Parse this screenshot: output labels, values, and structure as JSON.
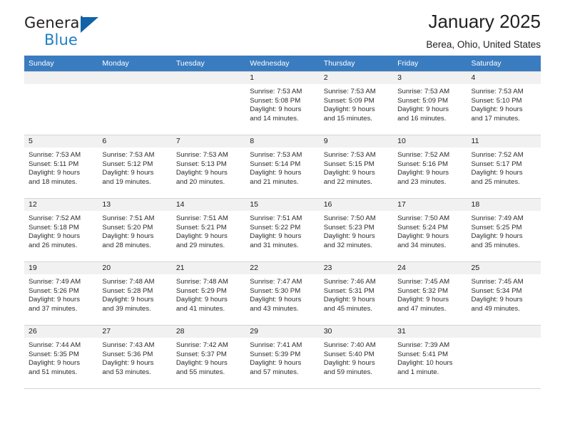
{
  "brand": {
    "name_top": "General",
    "name_bottom": "Blue",
    "triangle_color": "#1162a8",
    "blue_color": "#1f7fc4"
  },
  "header": {
    "title": "January 2025",
    "location": "Berea, Ohio, United States",
    "header_bg": "#3a7cc0"
  },
  "weekdays": [
    "Sunday",
    "Monday",
    "Tuesday",
    "Wednesday",
    "Thursday",
    "Friday",
    "Saturday"
  ],
  "weeks": [
    [
      {
        "day": "",
        "sunrise": "",
        "sunset": "",
        "daylight_1": "",
        "daylight_2": ""
      },
      {
        "day": "",
        "sunrise": "",
        "sunset": "",
        "daylight_1": "",
        "daylight_2": ""
      },
      {
        "day": "",
        "sunrise": "",
        "sunset": "",
        "daylight_1": "",
        "daylight_2": ""
      },
      {
        "day": "1",
        "sunrise": "Sunrise: 7:53 AM",
        "sunset": "Sunset: 5:08 PM",
        "daylight_1": "Daylight: 9 hours",
        "daylight_2": "and 14 minutes."
      },
      {
        "day": "2",
        "sunrise": "Sunrise: 7:53 AM",
        "sunset": "Sunset: 5:09 PM",
        "daylight_1": "Daylight: 9 hours",
        "daylight_2": "and 15 minutes."
      },
      {
        "day": "3",
        "sunrise": "Sunrise: 7:53 AM",
        "sunset": "Sunset: 5:09 PM",
        "daylight_1": "Daylight: 9 hours",
        "daylight_2": "and 16 minutes."
      },
      {
        "day": "4",
        "sunrise": "Sunrise: 7:53 AM",
        "sunset": "Sunset: 5:10 PM",
        "daylight_1": "Daylight: 9 hours",
        "daylight_2": "and 17 minutes."
      }
    ],
    [
      {
        "day": "5",
        "sunrise": "Sunrise: 7:53 AM",
        "sunset": "Sunset: 5:11 PM",
        "daylight_1": "Daylight: 9 hours",
        "daylight_2": "and 18 minutes."
      },
      {
        "day": "6",
        "sunrise": "Sunrise: 7:53 AM",
        "sunset": "Sunset: 5:12 PM",
        "daylight_1": "Daylight: 9 hours",
        "daylight_2": "and 19 minutes."
      },
      {
        "day": "7",
        "sunrise": "Sunrise: 7:53 AM",
        "sunset": "Sunset: 5:13 PM",
        "daylight_1": "Daylight: 9 hours",
        "daylight_2": "and 20 minutes."
      },
      {
        "day": "8",
        "sunrise": "Sunrise: 7:53 AM",
        "sunset": "Sunset: 5:14 PM",
        "daylight_1": "Daylight: 9 hours",
        "daylight_2": "and 21 minutes."
      },
      {
        "day": "9",
        "sunrise": "Sunrise: 7:53 AM",
        "sunset": "Sunset: 5:15 PM",
        "daylight_1": "Daylight: 9 hours",
        "daylight_2": "and 22 minutes."
      },
      {
        "day": "10",
        "sunrise": "Sunrise: 7:52 AM",
        "sunset": "Sunset: 5:16 PM",
        "daylight_1": "Daylight: 9 hours",
        "daylight_2": "and 23 minutes."
      },
      {
        "day": "11",
        "sunrise": "Sunrise: 7:52 AM",
        "sunset": "Sunset: 5:17 PM",
        "daylight_1": "Daylight: 9 hours",
        "daylight_2": "and 25 minutes."
      }
    ],
    [
      {
        "day": "12",
        "sunrise": "Sunrise: 7:52 AM",
        "sunset": "Sunset: 5:18 PM",
        "daylight_1": "Daylight: 9 hours",
        "daylight_2": "and 26 minutes."
      },
      {
        "day": "13",
        "sunrise": "Sunrise: 7:51 AM",
        "sunset": "Sunset: 5:20 PM",
        "daylight_1": "Daylight: 9 hours",
        "daylight_2": "and 28 minutes."
      },
      {
        "day": "14",
        "sunrise": "Sunrise: 7:51 AM",
        "sunset": "Sunset: 5:21 PM",
        "daylight_1": "Daylight: 9 hours",
        "daylight_2": "and 29 minutes."
      },
      {
        "day": "15",
        "sunrise": "Sunrise: 7:51 AM",
        "sunset": "Sunset: 5:22 PM",
        "daylight_1": "Daylight: 9 hours",
        "daylight_2": "and 31 minutes."
      },
      {
        "day": "16",
        "sunrise": "Sunrise: 7:50 AM",
        "sunset": "Sunset: 5:23 PM",
        "daylight_1": "Daylight: 9 hours",
        "daylight_2": "and 32 minutes."
      },
      {
        "day": "17",
        "sunrise": "Sunrise: 7:50 AM",
        "sunset": "Sunset: 5:24 PM",
        "daylight_1": "Daylight: 9 hours",
        "daylight_2": "and 34 minutes."
      },
      {
        "day": "18",
        "sunrise": "Sunrise: 7:49 AM",
        "sunset": "Sunset: 5:25 PM",
        "daylight_1": "Daylight: 9 hours",
        "daylight_2": "and 35 minutes."
      }
    ],
    [
      {
        "day": "19",
        "sunrise": "Sunrise: 7:49 AM",
        "sunset": "Sunset: 5:26 PM",
        "daylight_1": "Daylight: 9 hours",
        "daylight_2": "and 37 minutes."
      },
      {
        "day": "20",
        "sunrise": "Sunrise: 7:48 AM",
        "sunset": "Sunset: 5:28 PM",
        "daylight_1": "Daylight: 9 hours",
        "daylight_2": "and 39 minutes."
      },
      {
        "day": "21",
        "sunrise": "Sunrise: 7:48 AM",
        "sunset": "Sunset: 5:29 PM",
        "daylight_1": "Daylight: 9 hours",
        "daylight_2": "and 41 minutes."
      },
      {
        "day": "22",
        "sunrise": "Sunrise: 7:47 AM",
        "sunset": "Sunset: 5:30 PM",
        "daylight_1": "Daylight: 9 hours",
        "daylight_2": "and 43 minutes."
      },
      {
        "day": "23",
        "sunrise": "Sunrise: 7:46 AM",
        "sunset": "Sunset: 5:31 PM",
        "daylight_1": "Daylight: 9 hours",
        "daylight_2": "and 45 minutes."
      },
      {
        "day": "24",
        "sunrise": "Sunrise: 7:45 AM",
        "sunset": "Sunset: 5:32 PM",
        "daylight_1": "Daylight: 9 hours",
        "daylight_2": "and 47 minutes."
      },
      {
        "day": "25",
        "sunrise": "Sunrise: 7:45 AM",
        "sunset": "Sunset: 5:34 PM",
        "daylight_1": "Daylight: 9 hours",
        "daylight_2": "and 49 minutes."
      }
    ],
    [
      {
        "day": "26",
        "sunrise": "Sunrise: 7:44 AM",
        "sunset": "Sunset: 5:35 PM",
        "daylight_1": "Daylight: 9 hours",
        "daylight_2": "and 51 minutes."
      },
      {
        "day": "27",
        "sunrise": "Sunrise: 7:43 AM",
        "sunset": "Sunset: 5:36 PM",
        "daylight_1": "Daylight: 9 hours",
        "daylight_2": "and 53 minutes."
      },
      {
        "day": "28",
        "sunrise": "Sunrise: 7:42 AM",
        "sunset": "Sunset: 5:37 PM",
        "daylight_1": "Daylight: 9 hours",
        "daylight_2": "and 55 minutes."
      },
      {
        "day": "29",
        "sunrise": "Sunrise: 7:41 AM",
        "sunset": "Sunset: 5:39 PM",
        "daylight_1": "Daylight: 9 hours",
        "daylight_2": "and 57 minutes."
      },
      {
        "day": "30",
        "sunrise": "Sunrise: 7:40 AM",
        "sunset": "Sunset: 5:40 PM",
        "daylight_1": "Daylight: 9 hours",
        "daylight_2": "and 59 minutes."
      },
      {
        "day": "31",
        "sunrise": "Sunrise: 7:39 AM",
        "sunset": "Sunset: 5:41 PM",
        "daylight_1": "Daylight: 10 hours",
        "daylight_2": "and 1 minute."
      },
      {
        "day": "",
        "sunrise": "",
        "sunset": "",
        "daylight_1": "",
        "daylight_2": ""
      }
    ]
  ]
}
